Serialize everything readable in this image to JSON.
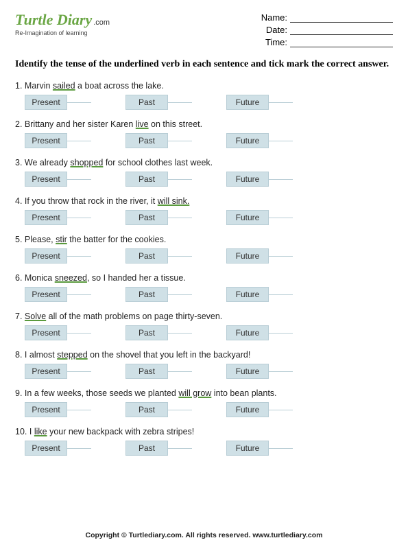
{
  "logo": {
    "main": "Turtle Diary",
    "com": ".com",
    "sub": "Re-Imagination of learning"
  },
  "fields": {
    "name": "Name:",
    "date": "Date:",
    "time": "Time:"
  },
  "instructions": "Identify the tense of the underlined verb in each sentence and tick mark the correct answer.",
  "opts": {
    "present": "Present",
    "past": "Past",
    "future": "Future"
  },
  "q": [
    {
      "n": "1.",
      "pre": "Marvin ",
      "u": "sailed",
      "post": " a boat across the lake."
    },
    {
      "n": "2.",
      "pre": "Brittany and her sister Karen ",
      "u": "live",
      "post": " on this street."
    },
    {
      "n": "3.",
      "pre": "We already ",
      "u": "shopped",
      "post": " for school clothes last week."
    },
    {
      "n": "4.",
      "pre": "If you throw that rock in the river, it ",
      "u": "will sink.",
      "post": ""
    },
    {
      "n": "5.",
      "pre": "Please, ",
      "u": "stir",
      "post": " the batter for the cookies."
    },
    {
      "n": "6.",
      "pre": "Monica ",
      "u": "sneezed",
      "post": ", so I handed her a tissue."
    },
    {
      "n": "7.",
      "pre": "",
      "u": "Solve",
      "post": " all of the math problems on page thirty-seven."
    },
    {
      "n": "8.",
      "pre": "I almost ",
      "u": "stepped",
      "post": " on the shovel that you left in the backyard!"
    },
    {
      "n": "9.",
      "pre": "In a few weeks, those seeds we planted ",
      "u": "will grow",
      "post": " into bean plants."
    },
    {
      "n": "10.",
      "pre": "I ",
      "u": "like",
      "post": " your new backpack with zebra stripes!"
    }
  ],
  "footer": "Copyright © Turtlediary.com. All rights reserved. www.turtlediary.com"
}
